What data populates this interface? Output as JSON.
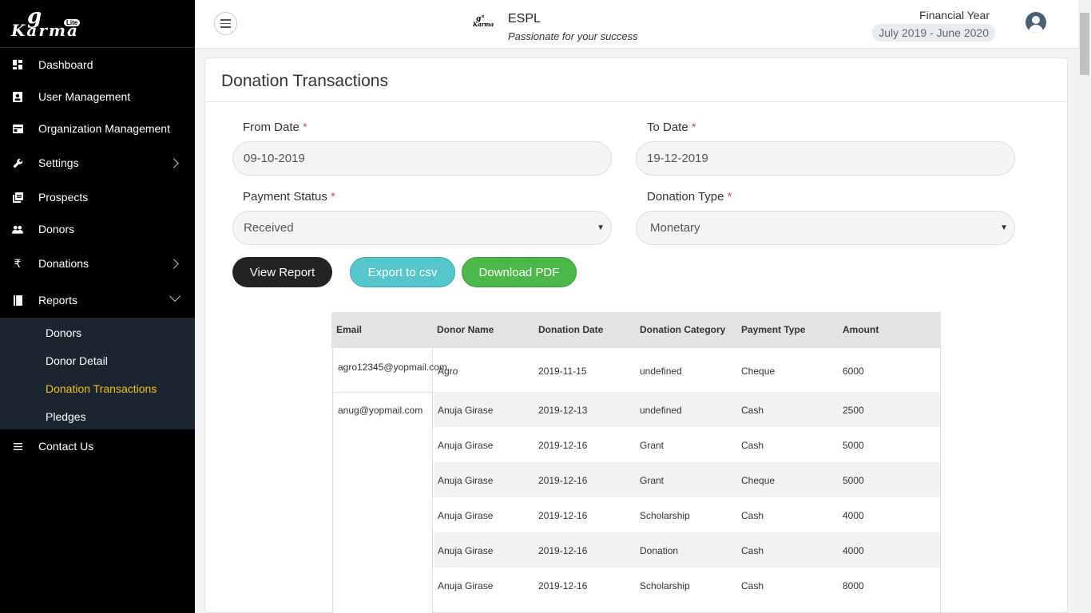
{
  "sidebar": {
    "logo": {
      "main": "Karma",
      "prefix": "g",
      "badge": "Lite"
    },
    "items": [
      {
        "label": "Dashboard",
        "icon": "dashboard-icon"
      },
      {
        "label": "User Management",
        "icon": "user-card-icon"
      },
      {
        "label": "Organization Management",
        "icon": "organization-icon"
      },
      {
        "label": "Settings",
        "icon": "wrench-icon"
      },
      {
        "label": "Prospects",
        "icon": "prospects-icon"
      },
      {
        "label": "Donors",
        "icon": "people-icon"
      },
      {
        "label": "Donations",
        "icon": "rupee-icon"
      },
      {
        "label": "Reports",
        "icon": "book-icon"
      },
      {
        "label": "Contact Us",
        "icon": "list-icon"
      }
    ],
    "reports_sub": [
      {
        "label": "Donors"
      },
      {
        "label": "Donor Detail"
      },
      {
        "label": "Donation Transactions"
      },
      {
        "label": "Pledges"
      }
    ]
  },
  "header": {
    "org_name": "ESPL",
    "tagline": "Passionate for your success",
    "financial_year_label": "Financial Year",
    "financial_year_value": "July 2019 - June 2020"
  },
  "page": {
    "title": "Donation Transactions",
    "form": {
      "from_date_label": "From Date",
      "from_date_value": "09-10-2019",
      "to_date_label": "To Date",
      "to_date_value": "19-12-2019",
      "payment_status_label": "Payment Status",
      "payment_status_value": "Received",
      "donation_type_label": "Donation Type",
      "donation_type_value": "Monetary",
      "required_mark": "*"
    },
    "buttons": {
      "view_report": "View Report",
      "export_csv": "Export to csv",
      "download_pdf": "Download PDF"
    }
  },
  "table": {
    "headers": [
      "Email",
      "Donor Name",
      "Donation Date",
      "Donation Category",
      "Payment Type",
      "Amount"
    ],
    "emails": [
      "agro12345@yopmail.com",
      "anug@yopmail.com"
    ],
    "rows": [
      [
        "Agro",
        "2019-11-15",
        "undefined",
        "Cheque",
        "6000"
      ],
      [
        "Anuja Girase",
        "2019-12-13",
        "undefined",
        "Cash",
        "2500"
      ],
      [
        "Anuja Girase",
        "2019-12-16",
        "Grant",
        "Cash",
        "5000"
      ],
      [
        "Anuja Girase",
        "2019-12-16",
        "Grant",
        "Cheque",
        "5000"
      ],
      [
        "Anuja Girase",
        "2019-12-16",
        "Scholarship",
        "Cash",
        "4000"
      ],
      [
        "Anuja Girase",
        "2019-12-16",
        "Donation",
        "Cash",
        "4000"
      ],
      [
        "Anuja Girase",
        "2019-12-16",
        "Scholarship",
        "Cash",
        "8000"
      ]
    ]
  }
}
